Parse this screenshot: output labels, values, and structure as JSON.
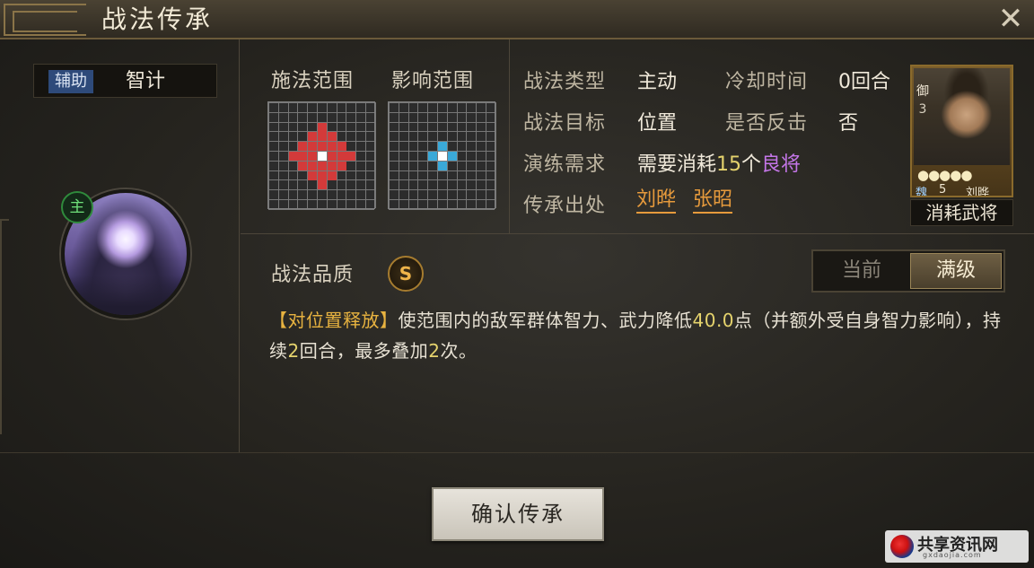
{
  "window": {
    "title": "战法传承",
    "close_icon": "close-icon"
  },
  "skill": {
    "role_badge": "辅助",
    "name": "智计",
    "main_tag": "主",
    "quality_label": "战法品质",
    "quality": "S"
  },
  "ranges": {
    "cast_label": "施法范围",
    "effect_label": "影响范围",
    "cast_color": "#d33a3a",
    "effect_color": "#3aa9d8"
  },
  "info": {
    "type_label": "战法类型",
    "type_value": "主动",
    "cooldown_label": "冷却时间",
    "cooldown_value": "0回合",
    "target_label": "战法目标",
    "target_value": "位置",
    "counter_label": "是否反击",
    "counter_value": "否",
    "training_label": "演练需求",
    "training_prefix": "需要消耗",
    "training_count": "15",
    "training_unit": "个",
    "training_quality": "良将",
    "source_label": "传承出处",
    "source_generals": [
      "刘晔",
      "张昭"
    ]
  },
  "general_card": {
    "type": "御",
    "cost": "3",
    "stars": "●●●●●",
    "faction": "魏",
    "level": "5",
    "name": "刘晔",
    "consume_label": "消耗武将"
  },
  "level_toggle": {
    "current": "当前",
    "max": "满级",
    "selected": "max"
  },
  "description": {
    "tag": "【对位置释放】",
    "part1": "使范围内的敌军群体智力、武力降低",
    "num1": "40.0",
    "part2": "点（并额外受自身智力影响），持续",
    "num2": "2",
    "part3": "回合，最多叠加",
    "num3": "2",
    "part4": "次。"
  },
  "confirm_button": "确认传承",
  "watermark": {
    "text": "共享资讯网",
    "sub": "gxdaojia.com"
  }
}
